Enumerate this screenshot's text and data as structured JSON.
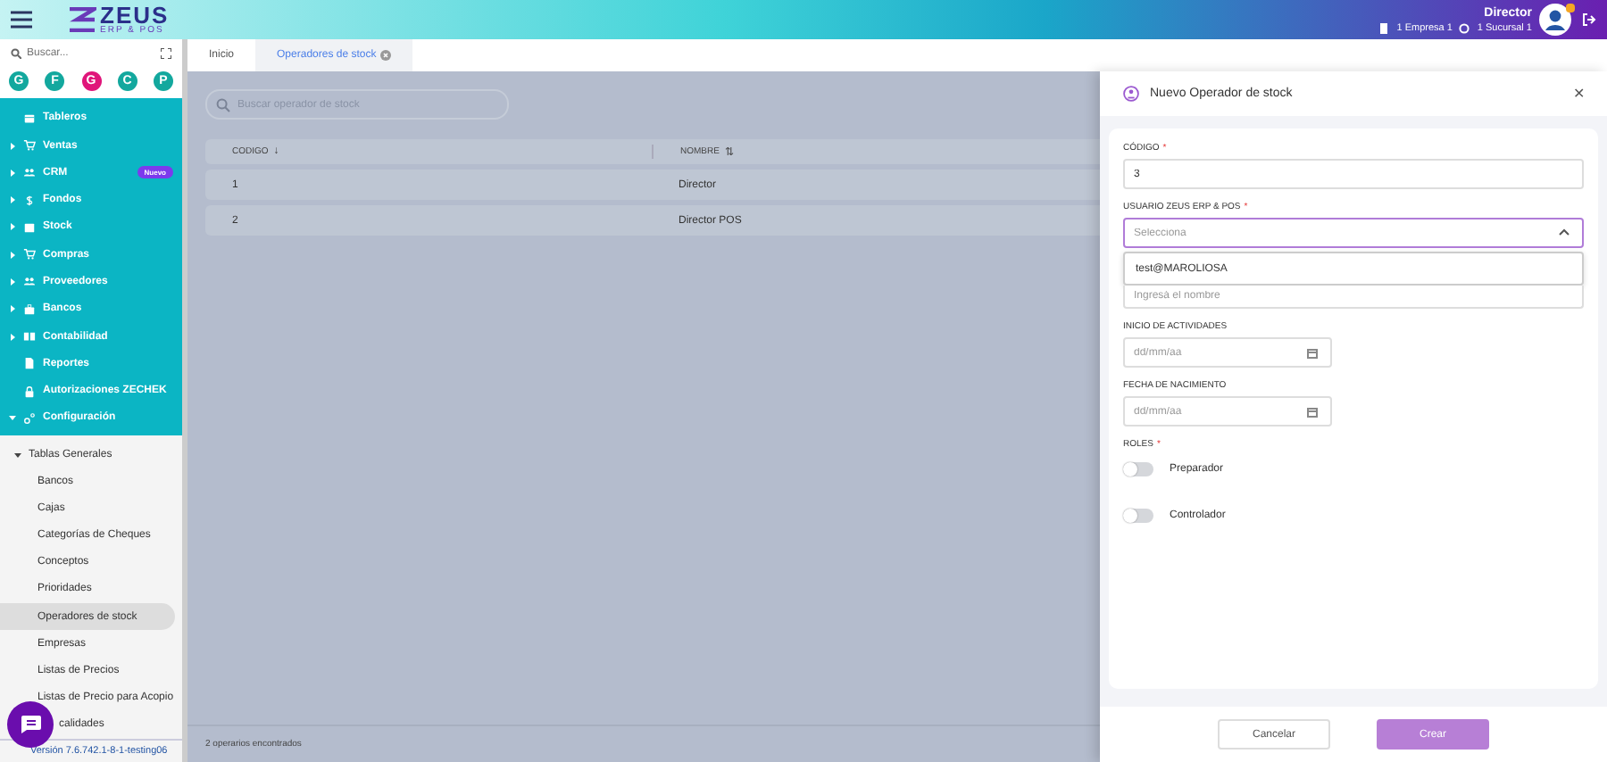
{
  "header": {
    "logo": "ZEUS",
    "logo_sub": "ERP & POS",
    "user": "Director",
    "company": "1 Empresa 1",
    "branch": "1 Sucursal 1"
  },
  "sidebar": {
    "search": {
      "placeholder": "Buscar..."
    },
    "shortcuts": [
      {
        "label": "G",
        "color": "#13a89e"
      },
      {
        "label": "F",
        "color": "#13a89e"
      },
      {
        "label": "G",
        "color": "#e0157a"
      },
      {
        "label": "C",
        "color": "#13a89e"
      },
      {
        "label": "P",
        "color": "#13a89e"
      }
    ],
    "menu": [
      {
        "label": "Tableros",
        "kind": "grid",
        "expandable": false
      },
      {
        "label": "Ventas",
        "kind": "cart",
        "expandable": true,
        "expanded": false
      },
      {
        "label": "CRM",
        "kind": "people",
        "expandable": true,
        "expanded": false,
        "badge": "Nuevo"
      },
      {
        "label": "Fondos",
        "kind": "dollar",
        "expandable": true,
        "expanded": false
      },
      {
        "label": "Stock",
        "kind": "box",
        "expandable": true,
        "expanded": false
      },
      {
        "label": "Compras",
        "kind": "cart",
        "expandable": true,
        "expanded": false
      },
      {
        "label": "Proveedores",
        "kind": "people",
        "expandable": true,
        "expanded": false
      },
      {
        "label": "Bancos",
        "kind": "case",
        "expandable": true,
        "expanded": false
      },
      {
        "label": "Contabilidad",
        "kind": "book",
        "expandable": true,
        "expanded": false
      },
      {
        "label": "Reportes",
        "kind": "doc",
        "expandable": false
      },
      {
        "label": "Autorizaciones ZECHEK",
        "kind": "lock",
        "expandable": false
      },
      {
        "label": "Configuración",
        "kind": "gear",
        "expandable": true,
        "expanded": true
      }
    ],
    "submenu": {
      "label": "Tablas Generales",
      "expanded": true,
      "children": [
        {
          "label": "Bancos",
          "selected": false
        },
        {
          "label": "Cajas",
          "selected": false
        },
        {
          "label": "Categorías de Cheques",
          "selected": false
        },
        {
          "label": "Conceptos",
          "selected": false
        },
        {
          "label": "Prioridades",
          "selected": false
        },
        {
          "label": "Operadores de stock",
          "selected": true
        },
        {
          "label": "Empresas",
          "selected": false
        },
        {
          "label": "Listas de Precios",
          "selected": false
        },
        {
          "label": "Listas de Precio para Acopio",
          "selected": false
        },
        {
          "label": "calidades",
          "selected": false
        }
      ]
    },
    "version": "Versión 7.6.742.1-8-1-testing06"
  },
  "tabs": [
    {
      "label": "Inicio",
      "selected": false,
      "closable": false
    },
    {
      "label": "Operadores de stock",
      "selected": true,
      "closable": true
    }
  ],
  "list": {
    "search": {
      "placeholder": "Buscar operador de stock"
    },
    "columns": [
      {
        "label": "CODIGO",
        "sort_icon": "↓"
      },
      {
        "label": "NOMBRE",
        "sort_icon": "⇅"
      }
    ],
    "rows": [
      [
        "1",
        "Director"
      ],
      [
        "2",
        "Director POS"
      ]
    ],
    "footer": "2 operarios encontrados"
  },
  "drawer": {
    "title": "Nuevo Operador de stock",
    "close": "✕",
    "fields": [
      {
        "kind": "text",
        "label": "CÓDIGO",
        "required_mark": "*",
        "value": "3"
      },
      {
        "kind": "select",
        "label": "USUARIO ZEUS ERP & POS",
        "required_mark": "*",
        "placeholder": "Selecciona",
        "focused": true,
        "options": [
          "test@MAROLIOSA"
        ]
      },
      {
        "kind": "text",
        "placeholder": "Ingresá el nombre"
      },
      {
        "kind": "date",
        "label": "INICIO DE ACTIVIDADES",
        "placeholder": "dd/mm/aa"
      },
      {
        "kind": "date",
        "label": "FECHA DE NACIMIENTO",
        "placeholder": "dd/mm/aa"
      }
    ],
    "roles": {
      "label": "ROLES",
      "required_mark": "*",
      "items": [
        {
          "label": "Preparador",
          "on": false
        },
        {
          "label": "Controlador",
          "on": false
        }
      ]
    },
    "buttons": [
      {
        "label": "Cancelar",
        "kind": "secondary"
      },
      {
        "label": "Crear",
        "kind": "primary"
      }
    ]
  }
}
